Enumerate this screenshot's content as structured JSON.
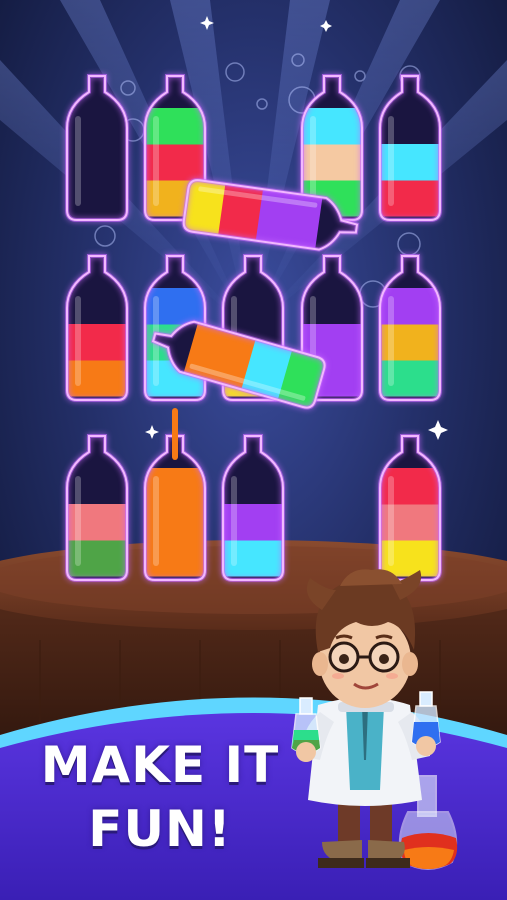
{
  "promo": {
    "headline_line1": "MAKE IT",
    "headline_line2": "FUN!"
  },
  "palette": {
    "background_center": "#3a4a9a",
    "background_edge": "#0e1430",
    "banner_purple": "#4a2fd0",
    "banner_edge": "#5fd6ff",
    "table_wood": "#6b3a26",
    "bottle_outline": "#f2b8ff",
    "bottle_glow": "#c86bff"
  },
  "colors": {
    "green": "#2fe05a",
    "red": "#f22a4a",
    "yellow": "#f7e21c",
    "cyan": "#46e6ff",
    "peach": "#f5c9a2",
    "blue": "#2f6ff0",
    "teal": "#2cde8c",
    "purple": "#a23ff2",
    "orange": "#f77a16",
    "gold": "#f1b21d",
    "salmon": "#f0787e",
    "moss": "#4fa447",
    "empty": "#1a1540"
  },
  "board": {
    "rows": [
      {
        "row": 1,
        "bottles": [
          {
            "id": "r1b1",
            "layers_bottom_to_top": []
          },
          {
            "id": "r1b2",
            "layers_bottom_to_top": [
              "gold",
              "red",
              "green"
            ]
          },
          {
            "id": "r1b3",
            "layers_bottom_to_top": [
              "green",
              "peach",
              "cyan"
            ]
          },
          {
            "id": "r1b4",
            "layers_bottom_to_top": [
              "red",
              "cyan"
            ]
          }
        ]
      },
      {
        "row": 2,
        "bottles": [
          {
            "id": "r2b1",
            "layers_bottom_to_top": [
              "orange",
              "red"
            ]
          },
          {
            "id": "r2b2",
            "layers_bottom_to_top": [
              "cyan",
              "teal",
              "blue"
            ]
          },
          {
            "id": "r2b3",
            "layers_bottom_to_top": [
              "yellow"
            ]
          },
          {
            "id": "r2b4",
            "layers_bottom_to_top": [
              "purple",
              "purple"
            ]
          },
          {
            "id": "r2b5",
            "layers_bottom_to_top": [
              "teal",
              "gold",
              "purple"
            ]
          }
        ]
      },
      {
        "row": 3,
        "bottles": [
          {
            "id": "r3b1",
            "layers_bottom_to_top": [
              "moss",
              "salmon"
            ]
          },
          {
            "id": "r3b2",
            "layers_bottom_to_top": [
              "orange",
              "orange",
              "orange"
            ]
          },
          {
            "id": "r3b3",
            "layers_bottom_to_top": [
              "cyan",
              "purple"
            ]
          },
          {
            "id": "r3b4",
            "layers_bottom_to_top": [
              "yellow",
              "salmon",
              "red"
            ]
          }
        ]
      }
    ],
    "pouring": [
      {
        "id": "pour-top",
        "layers_from_base_to_neck": [
          "yellow",
          "red",
          "purple"
        ]
      },
      {
        "id": "pour-middle",
        "layers_from_base_to_neck": [
          "green",
          "cyan",
          "orange"
        ]
      }
    ]
  },
  "character": {
    "description_icon": "scientist-boy",
    "left_flask": [
      "green",
      "teal"
    ],
    "right_flask": [
      "blue"
    ],
    "floor_flask": [
      "red",
      "orange"
    ]
  }
}
